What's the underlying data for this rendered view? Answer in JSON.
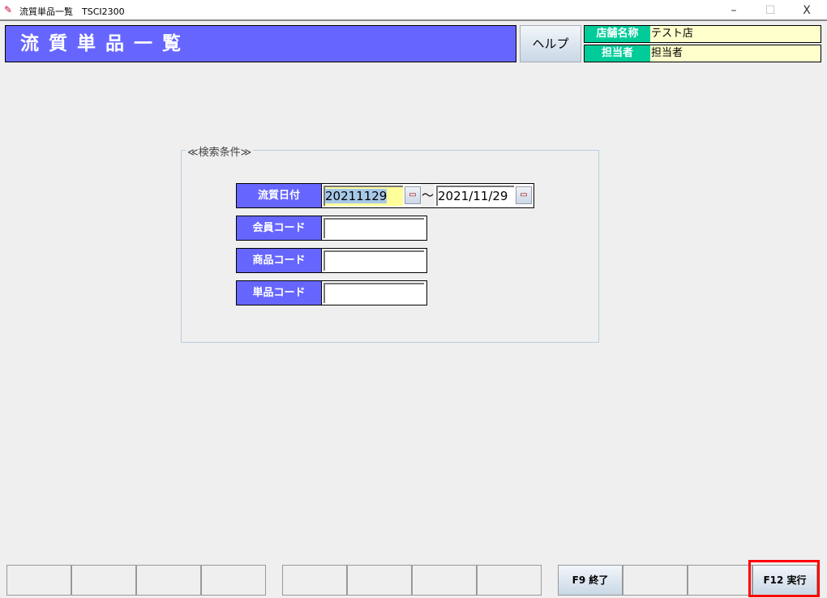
{
  "window": {
    "title": "流質単品一覧　TSCI2300",
    "minimize": "–",
    "maximize": "☐",
    "close": "X"
  },
  "header": {
    "title": "流質単品一覧",
    "help_label": "ヘルプ",
    "store": {
      "label": "店舗名称",
      "value": "テスト店"
    },
    "staff": {
      "label": "担当者",
      "value": "担当者"
    }
  },
  "search": {
    "legend": "≪検索条件≫",
    "date": {
      "label": "流質日付",
      "from": "20211129",
      "separator": "～",
      "to": "2021/11/29"
    },
    "member": {
      "label": "会員コード",
      "value": ""
    },
    "product": {
      "label": "商品コード",
      "value": ""
    },
    "item": {
      "label": "単品コード",
      "value": ""
    }
  },
  "fkeys": [
    "",
    "",
    "",
    "",
    "",
    "",
    "",
    "",
    "F9 終了",
    "",
    "",
    "F12 実行"
  ]
}
